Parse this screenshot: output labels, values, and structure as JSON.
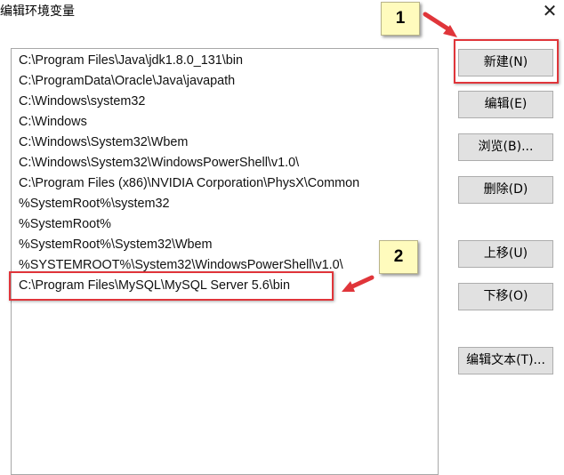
{
  "window": {
    "title": "编辑环境变量",
    "close_glyph": "✕"
  },
  "paths": [
    "C:\\Program Files\\Java\\jdk1.8.0_131\\bin",
    "C:\\ProgramData\\Oracle\\Java\\javapath",
    "C:\\Windows\\system32",
    "C:\\Windows",
    "C:\\Windows\\System32\\Wbem",
    "C:\\Windows\\System32\\WindowsPowerShell\\v1.0\\",
    "C:\\Program Files (x86)\\NVIDIA Corporation\\PhysX\\Common",
    "%SystemRoot%\\system32",
    "%SystemRoot%",
    "%SystemRoot%\\System32\\Wbem",
    "%SYSTEMROOT%\\System32\\WindowsPowerShell\\v1.0\\",
    "C:\\Program Files\\MySQL\\MySQL Server 5.6\\bin"
  ],
  "buttons": {
    "new": "新建(N)",
    "edit": "编辑(E)",
    "browse": "浏览(B)...",
    "delete": "删除(D)",
    "move_up": "上移(U)",
    "move_down": "下移(O)",
    "edit_text": "编辑文本(T)..."
  },
  "annotations": {
    "step1": "1",
    "step2": "2",
    "highlight_color": "#e0353a",
    "badge_color": "#fffbbd"
  }
}
